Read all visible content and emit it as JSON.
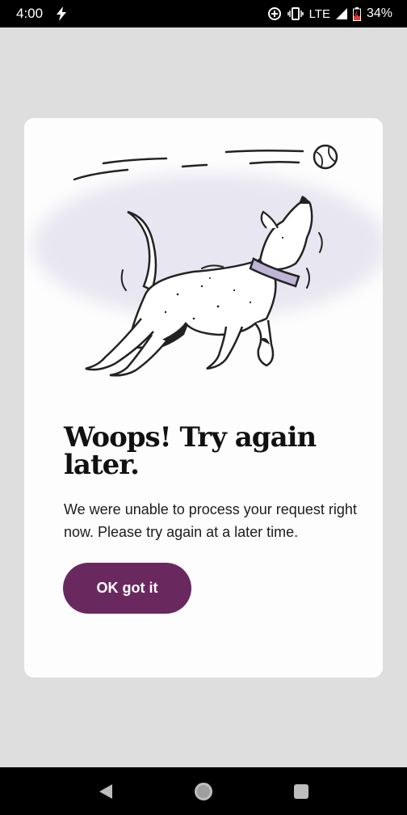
{
  "status_bar": {
    "time": "4:00",
    "network": "LTE",
    "battery": "34%",
    "icons": [
      "flash-icon",
      "data-saver-icon",
      "vibrate-icon",
      "signal-icon",
      "battery-icon"
    ]
  },
  "dialog": {
    "illustration": "dog-catching-ball",
    "title": "Woops! Try again later.",
    "message": "We were unable to process your request right now. Please try again at a later time.",
    "ok_label": "OK got it"
  },
  "nav_bar": {
    "icons": [
      "back-icon",
      "home-icon",
      "recents-icon"
    ]
  },
  "colors": {
    "button": "#69295f",
    "background": "#dedede",
    "card": "#fdfdfd",
    "collar": "#bdb4d6"
  }
}
